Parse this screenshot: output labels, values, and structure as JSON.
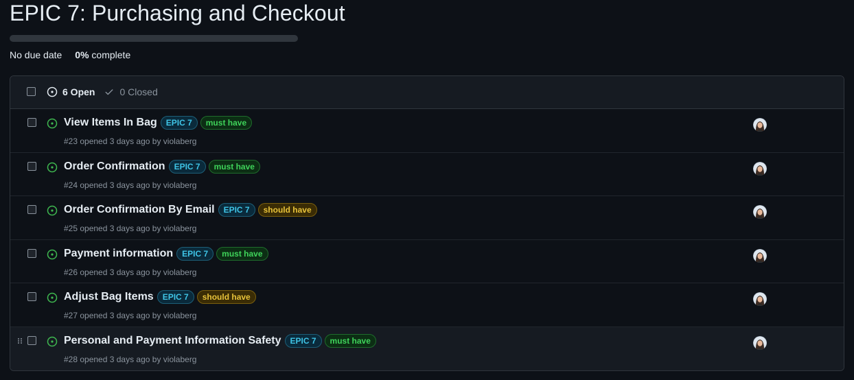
{
  "milestone": {
    "title": "EPIC 7: Purchasing and Checkout",
    "progress_fraction": 0,
    "due_date": "No due date",
    "percent": "0%",
    "complete_label": "complete"
  },
  "issues_header": {
    "open_label": "6 Open",
    "closed_label": "0 Closed"
  },
  "issues": [
    {
      "title": "View Items In Bag",
      "labels": [
        {
          "text": "EPIC 7",
          "kind": "epic"
        },
        {
          "text": "must have",
          "kind": "must"
        }
      ],
      "meta": "#23 opened 3 days ago by violaberg"
    },
    {
      "title": "Order Confirmation",
      "labels": [
        {
          "text": "EPIC 7",
          "kind": "epic"
        },
        {
          "text": "must have",
          "kind": "must"
        }
      ],
      "meta": "#24 opened 3 days ago by violaberg"
    },
    {
      "title": "Order Confirmation By Email",
      "labels": [
        {
          "text": "EPIC 7",
          "kind": "epic"
        },
        {
          "text": "should have",
          "kind": "should"
        }
      ],
      "meta": "#25 opened 3 days ago by violaberg"
    },
    {
      "title": "Payment information",
      "labels": [
        {
          "text": "EPIC 7",
          "kind": "epic"
        },
        {
          "text": "must have",
          "kind": "must"
        }
      ],
      "meta": "#26 opened 3 days ago by violaberg"
    },
    {
      "title": "Adjust Bag Items",
      "labels": [
        {
          "text": "EPIC 7",
          "kind": "epic"
        },
        {
          "text": "should have",
          "kind": "should"
        }
      ],
      "meta": "#27 opened 3 days ago by violaberg"
    },
    {
      "title": "Personal and Payment Information Safety",
      "labels": [
        {
          "text": "EPIC 7",
          "kind": "epic"
        },
        {
          "text": "must have",
          "kind": "must"
        }
      ],
      "meta": "#28 opened 3 days ago by violaberg"
    }
  ],
  "icons": {
    "open_issue": "issue-opened-icon",
    "closed": "check-icon",
    "avatar": "avatar",
    "drag": "grabber-icon"
  },
  "colors": {
    "open_issue": "#3fb950",
    "must_have": "#3fd35a",
    "should_have": "#e8c33a",
    "epic": "#3fc4e6"
  }
}
